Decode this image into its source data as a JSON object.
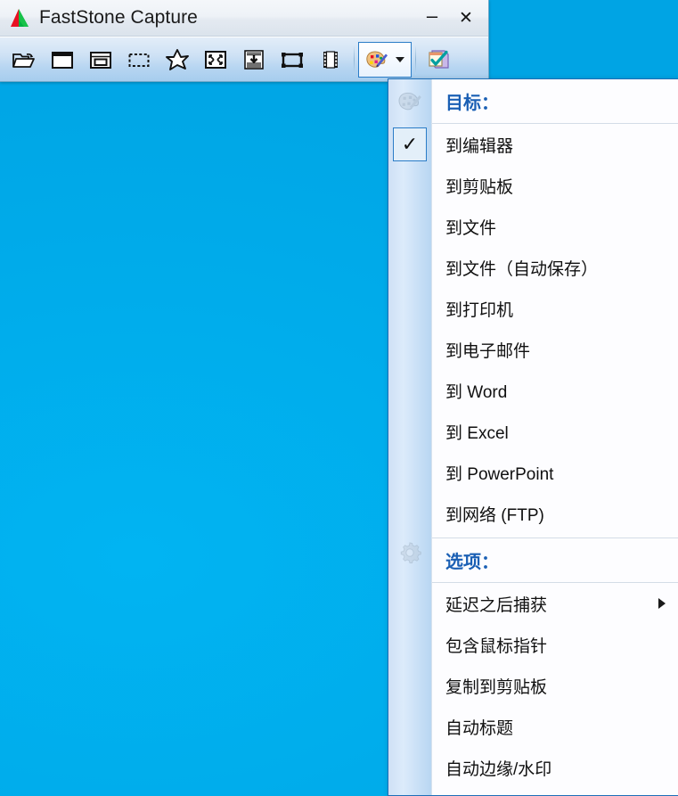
{
  "window": {
    "title": "FastStone Capture",
    "logo_icon": "faststone-logo-icon",
    "minimize_label": "–",
    "close_label": "✕"
  },
  "toolbar": {
    "buttons": [
      {
        "name": "open-file-button",
        "icon": "open-folder-icon"
      },
      {
        "name": "capture-active-window",
        "icon": "window-icon"
      },
      {
        "name": "capture-window-object",
        "icon": "window-object-icon"
      },
      {
        "name": "capture-rectangle",
        "icon": "dashed-rectangle-icon"
      },
      {
        "name": "capture-freehand",
        "icon": "star-freehand-icon"
      },
      {
        "name": "capture-fullscreen",
        "icon": "fullscreen-arrows-icon"
      },
      {
        "name": "capture-scrolling-window",
        "icon": "scrolling-window-icon"
      },
      {
        "name": "capture-fixed-region",
        "icon": "fixed-region-icon"
      },
      {
        "name": "screen-recorder",
        "icon": "film-strip-icon"
      }
    ],
    "output_combo": {
      "name": "output-destination-combo",
      "icon": "palette-pencil-icon",
      "caret": "chevron-down-icon"
    },
    "settings_button": {
      "name": "settings-button",
      "icon": "clipboard-check-icon"
    }
  },
  "menu": {
    "sections": [
      {
        "header": "目标：",
        "header_icon": "palette-pencil-icon",
        "items": [
          {
            "label": "到编辑器",
            "checked": true,
            "submenu": false
          },
          {
            "label": "到剪贴板",
            "checked": false,
            "submenu": false
          },
          {
            "label": "到文件",
            "checked": false,
            "submenu": false
          },
          {
            "label": "到文件（自动保存）",
            "checked": false,
            "submenu": false
          },
          {
            "label": "到打印机",
            "checked": false,
            "submenu": false
          },
          {
            "label": "到电子邮件",
            "checked": false,
            "submenu": false
          },
          {
            "label": "到 Word",
            "checked": false,
            "submenu": false
          },
          {
            "label": "到 Excel",
            "checked": false,
            "submenu": false
          },
          {
            "label": "到 PowerPoint",
            "checked": false,
            "submenu": false
          },
          {
            "label": "到网络 (FTP)",
            "checked": false,
            "submenu": false
          }
        ]
      },
      {
        "header": "选项：",
        "header_icon": "gear-icon",
        "items": [
          {
            "label": "延迟之后捕获",
            "checked": false,
            "submenu": true
          },
          {
            "label": "包含鼠标指针",
            "checked": false,
            "submenu": false
          },
          {
            "label": "复制到剪贴板",
            "checked": false,
            "submenu": false
          },
          {
            "label": "自动标题",
            "checked": false,
            "submenu": false
          },
          {
            "label": "自动边缘/水印",
            "checked": false,
            "submenu": false
          }
        ]
      }
    ]
  },
  "colors": {
    "desktop": "#00aae8",
    "accent_blue": "#1a5fb4",
    "menu_border": "#1e6fb8",
    "titlebar": "#eef2f7"
  }
}
